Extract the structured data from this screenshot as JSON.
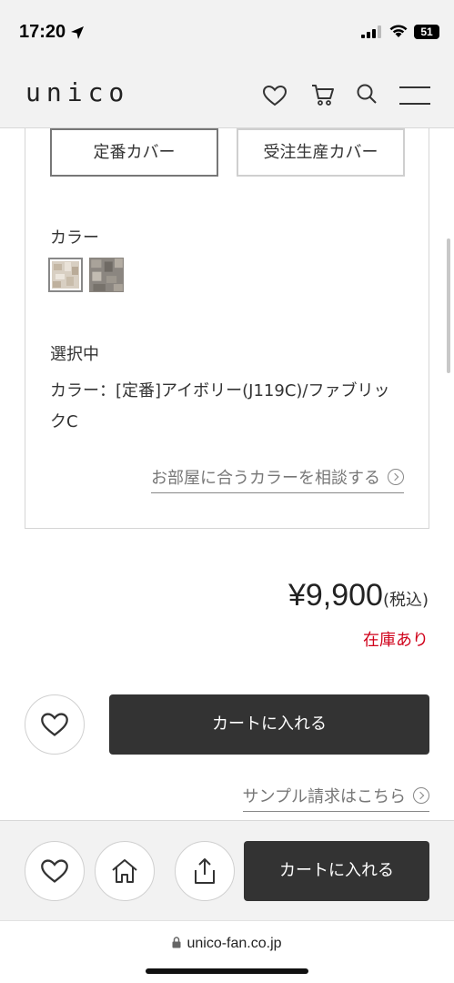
{
  "status_bar": {
    "time": "17:20",
    "battery": "51"
  },
  "header": {
    "logo": "unico",
    "icons": [
      "heart-icon",
      "cart-icon",
      "search-icon",
      "menu-icon"
    ]
  },
  "cover_options": {
    "standard": "定番カバー",
    "custom": "受注生産カバー",
    "selected": "定番カバー"
  },
  "color": {
    "label": "カラー",
    "swatches": [
      {
        "name": "ivory-swatch",
        "color": "#d8cfc2",
        "selected": true
      },
      {
        "name": "gray-swatch",
        "color": "#8b8680",
        "selected": false
      }
    ]
  },
  "selection": {
    "label": "選択中",
    "value": "カラー：[定番]アイボリー(J119C)/ファブリックC"
  },
  "consult_link": "お部屋に合うカラーを相談する",
  "price": {
    "amount": "¥9,900",
    "tax_note": "(税込)",
    "stock": "在庫あり"
  },
  "cart_button": "カートに入れる",
  "sample_link": "サンプル請求はこちら",
  "bottom_bar": {
    "cart_button": "カートに入れる"
  },
  "url_bar": {
    "domain": "unico-fan.co.jp"
  },
  "colors": {
    "accent_dark": "#333333",
    "stock_red": "#d0021b",
    "bar_bg": "#f2f2f2"
  }
}
